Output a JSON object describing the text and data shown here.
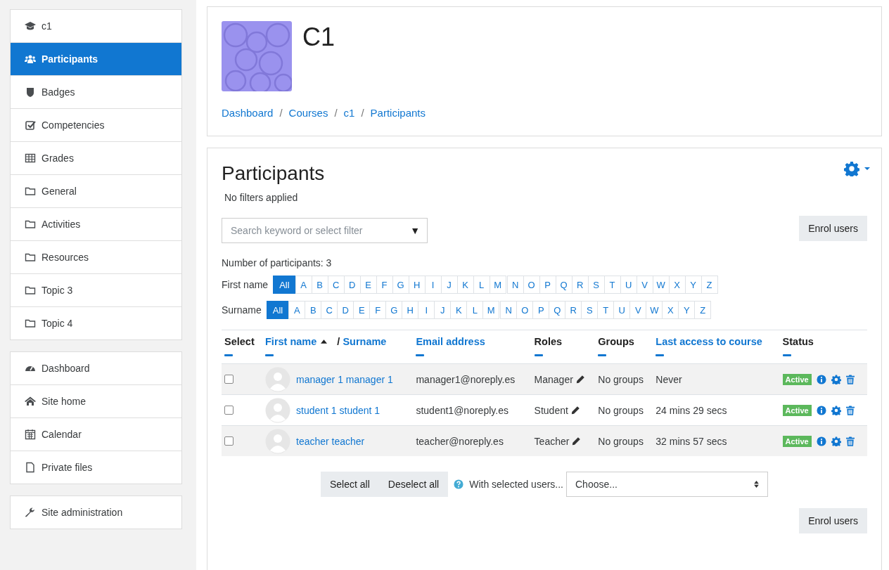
{
  "sidebar": {
    "groups": [
      [
        {
          "label": "c1",
          "kind": "cap",
          "selected": false
        },
        {
          "label": "Participants",
          "kind": "users",
          "selected": true
        },
        {
          "label": "Badges",
          "kind": "shield",
          "selected": false
        },
        {
          "label": "Competencies",
          "kind": "check",
          "selected": false
        },
        {
          "label": "Grades",
          "kind": "table",
          "selected": false
        },
        {
          "label": "General",
          "kind": "folder",
          "selected": false
        },
        {
          "label": "Activities",
          "kind": "folder",
          "selected": false
        },
        {
          "label": "Resources",
          "kind": "folder",
          "selected": false
        },
        {
          "label": "Topic 3",
          "kind": "folder",
          "selected": false
        },
        {
          "label": "Topic 4",
          "kind": "folder",
          "selected": false
        }
      ],
      [
        {
          "label": "Dashboard",
          "kind": "gauge",
          "selected": false
        },
        {
          "label": "Site home",
          "kind": "home",
          "selected": false
        },
        {
          "label": "Calendar",
          "kind": "calendar",
          "selected": false
        },
        {
          "label": "Private files",
          "kind": "file",
          "selected": false
        }
      ],
      [
        {
          "label": "Site administration",
          "kind": "wrench",
          "selected": false
        }
      ]
    ]
  },
  "header": {
    "title": "C1",
    "breadcrumb": [
      {
        "text": "Dashboard",
        "kind": "link"
      },
      {
        "text": "/",
        "kind": "separator"
      },
      {
        "text": "Courses",
        "kind": "link"
      },
      {
        "text": "/",
        "kind": "separator"
      },
      {
        "text": "c1",
        "kind": "link"
      },
      {
        "text": "/",
        "kind": "separator"
      },
      {
        "text": "Participants",
        "kind": "link"
      }
    ]
  },
  "participants": {
    "title": "Participants",
    "filters_note": "No filters applied",
    "enrol_button": "Enrol users",
    "search": {
      "placeholder": "Search keyword or select filter",
      "caret": "▼"
    },
    "count": "Number of participants: 3",
    "initials_bars": [
      {
        "label": "First name",
        "letters": [
          {
            "text": "All",
            "selected": true
          },
          {
            "text": "A",
            "selected": false
          },
          {
            "text": "B",
            "selected": false
          },
          {
            "text": "C",
            "selected": false
          },
          {
            "text": "D",
            "selected": false
          },
          {
            "text": "E",
            "selected": false
          },
          {
            "text": "F",
            "selected": false
          },
          {
            "text": "G",
            "selected": false
          },
          {
            "text": "H",
            "selected": false
          },
          {
            "text": "I",
            "selected": false
          },
          {
            "text": "J",
            "selected": false
          },
          {
            "text": "K",
            "selected": false
          },
          {
            "text": "L",
            "selected": false
          },
          {
            "text": "M",
            "selected": false
          },
          {
            "text": "N",
            "selected": false
          },
          {
            "text": "O",
            "selected": false
          },
          {
            "text": "P",
            "selected": false
          },
          {
            "text": "Q",
            "selected": false
          },
          {
            "text": "R",
            "selected": false
          },
          {
            "text": "S",
            "selected": false
          },
          {
            "text": "T",
            "selected": false
          },
          {
            "text": "U",
            "selected": false
          },
          {
            "text": "V",
            "selected": false
          },
          {
            "text": "W",
            "selected": false
          },
          {
            "text": "X",
            "selected": false
          },
          {
            "text": "Y",
            "selected": false
          },
          {
            "text": "Z",
            "selected": false
          }
        ]
      },
      {
        "label": "Surname",
        "letters": [
          {
            "text": "All",
            "selected": true
          },
          {
            "text": "A",
            "selected": false
          },
          {
            "text": "B",
            "selected": false
          },
          {
            "text": "C",
            "selected": false
          },
          {
            "text": "D",
            "selected": false
          },
          {
            "text": "E",
            "selected": false
          },
          {
            "text": "F",
            "selected": false
          },
          {
            "text": "G",
            "selected": false
          },
          {
            "text": "H",
            "selected": false
          },
          {
            "text": "I",
            "selected": false
          },
          {
            "text": "J",
            "selected": false
          },
          {
            "text": "K",
            "selected": false
          },
          {
            "text": "L",
            "selected": false
          },
          {
            "text": "M",
            "selected": false
          },
          {
            "text": "N",
            "selected": false
          },
          {
            "text": "O",
            "selected": false
          },
          {
            "text": "P",
            "selected": false
          },
          {
            "text": "Q",
            "selected": false
          },
          {
            "text": "R",
            "selected": false
          },
          {
            "text": "S",
            "selected": false
          },
          {
            "text": "T",
            "selected": false
          },
          {
            "text": "U",
            "selected": false
          },
          {
            "text": "V",
            "selected": false
          },
          {
            "text": "W",
            "selected": false
          },
          {
            "text": "X",
            "selected": false
          },
          {
            "text": "Y",
            "selected": false
          },
          {
            "text": "Z",
            "selected": false
          }
        ]
      }
    ],
    "table": {
      "columns": [
        {
          "label": "Select",
          "kind": "plain",
          "sorted": false
        },
        {
          "label": "First name",
          "kind": "sortable",
          "sorted": true,
          "separator": "/",
          "second": "Surname"
        },
        {
          "label": "Email address",
          "kind": "sortable",
          "sorted": false
        },
        {
          "label": "Roles",
          "kind": "plain",
          "sorted": false
        },
        {
          "label": "Groups",
          "kind": "plain",
          "sorted": false
        },
        {
          "label": "Last access to course",
          "kind": "sortable",
          "sorted": false
        },
        {
          "label": "Status",
          "kind": "plain",
          "sorted": false
        }
      ],
      "rows": [
        {
          "checked": false,
          "name": "manager 1 manager 1",
          "email": "manager1@noreply.es",
          "role": "Manager",
          "groups": "No groups",
          "last_access": "Never",
          "status": "Active"
        },
        {
          "checked": false,
          "name": "student 1 student 1",
          "email": "student1@noreply.es",
          "role": "Student",
          "groups": "No groups",
          "last_access": "24 mins 29 secs",
          "status": "Active"
        },
        {
          "checked": false,
          "name": "teacher teacher",
          "email": "teacher@noreply.es",
          "role": "Teacher",
          "groups": "No groups",
          "last_access": "32 mins 57 secs",
          "status": "Active"
        }
      ]
    },
    "bulk": {
      "select_all": "Select all",
      "deselect_all": "Deselect all",
      "with_selected": "With selected users...",
      "choose": "Choose..."
    },
    "enrol_button_bottom": "Enrol users"
  }
}
